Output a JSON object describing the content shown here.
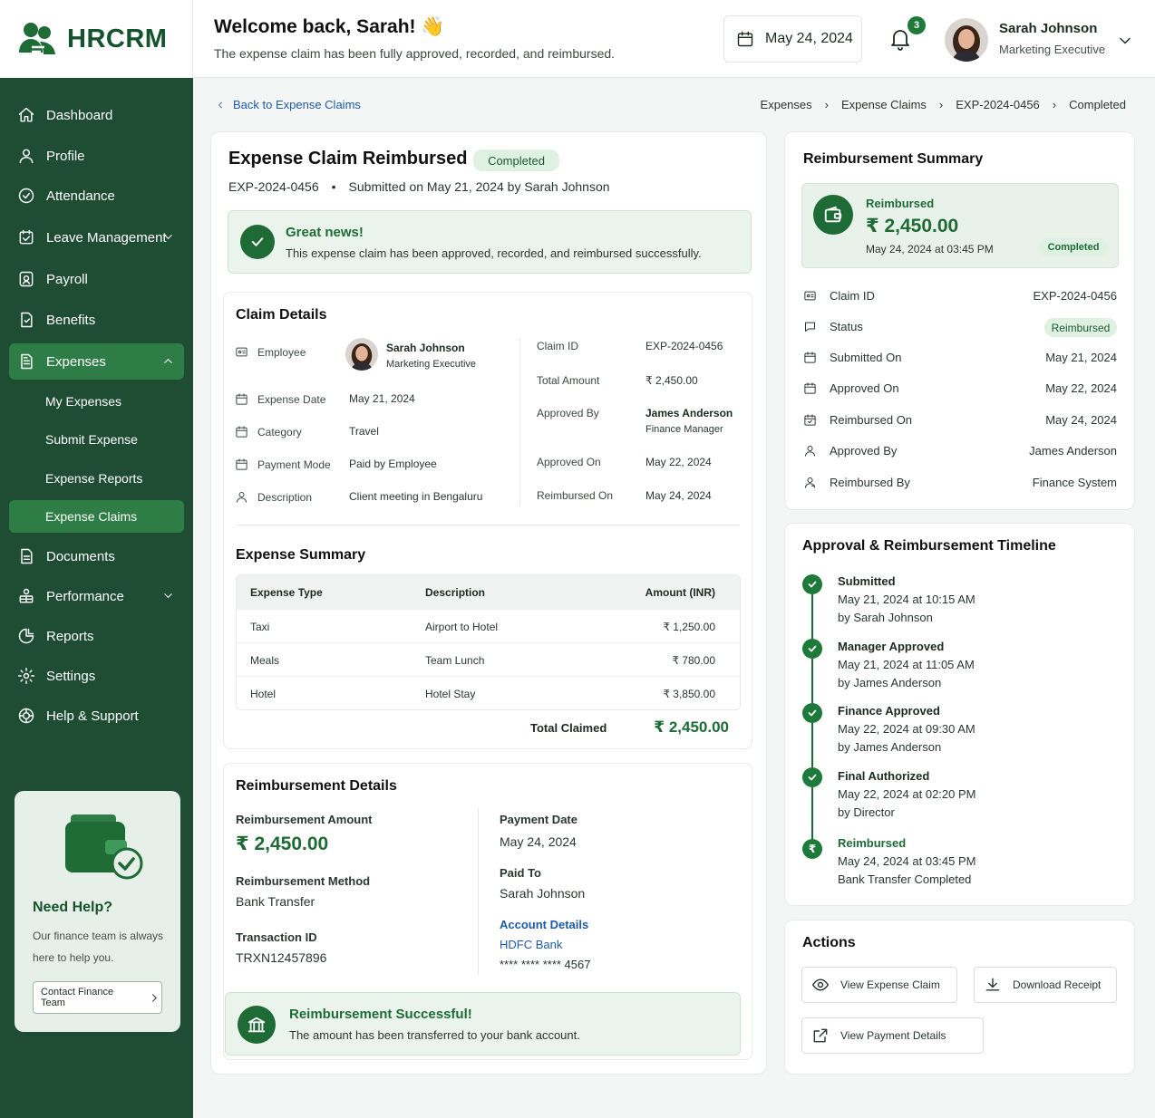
{
  "app": {
    "name": "HRCRM"
  },
  "sidebar": {
    "items": [
      {
        "label": "Dashboard"
      },
      {
        "label": "Profile"
      },
      {
        "label": "Attendance"
      },
      {
        "label": "Leave Management"
      },
      {
        "label": "Payroll"
      },
      {
        "label": "Benefits"
      },
      {
        "label": "Expenses"
      },
      {
        "label": "Documents"
      },
      {
        "label": "Performance"
      },
      {
        "label": "Reports"
      },
      {
        "label": "Settings"
      },
      {
        "label": "Help & Support"
      }
    ],
    "sub_items": [
      {
        "label": "My Expenses"
      },
      {
        "label": "Submit Expense"
      },
      {
        "label": "Expense Reports"
      },
      {
        "label": "Expense Claims"
      }
    ],
    "help": {
      "title": "Need Help?",
      "text": "Our finance team is always here to help you.",
      "button": "Contact Finance Team"
    }
  },
  "header": {
    "welcome": "Welcome back, Sarah! 👋",
    "subtitle": "The expense claim has been fully approved, recorded, and reimbursed.",
    "date": "May 24, 2024",
    "notification_count": "3",
    "user_name": "Sarah Johnson",
    "user_role": "Marketing Executive"
  },
  "breadcrumb": {
    "back": "Back to Expense Claims",
    "items": [
      "Expenses",
      "Expense Claims",
      "EXP-2024-0456",
      "Completed"
    ]
  },
  "claim": {
    "title": "Expense Claim Reimbursed",
    "status": "Completed",
    "id": "EXP-2024-0456",
    "submitted": "Submitted on May 21, 2024 by Sarah Johnson",
    "alert_title": "Great news!",
    "alert_text": "This expense claim has been approved, recorded, and reimbursed successfully."
  },
  "details": {
    "title": "Claim Details",
    "employee_label": "Employee",
    "employee_name": "Sarah Johnson",
    "employee_role": "Marketing Executive",
    "date_label": "Expense Date",
    "date": "May 21, 2024",
    "category_label": "Category",
    "category": "Travel",
    "payment_label": "Payment Mode",
    "payment": "Paid by Employee",
    "desc_label": "Description",
    "desc": "Client meeting in Bengaluru",
    "claim_id_label": "Claim ID",
    "claim_id": "EXP-2024-0456",
    "total_label": "Total Amount",
    "total": "₹ 2,450.00",
    "approved_by_label": "Approved By",
    "approved_by": "James Anderson",
    "approved_by_role": "Finance Manager",
    "approved_on_label": "Approved On",
    "approved_on": "May 22, 2024",
    "reimbursed_on_label": "Reimbursed On",
    "reimbursed_on": "May 24, 2024"
  },
  "expense_summary": {
    "title": "Expense Summary",
    "columns": [
      "Expense Type",
      "Description",
      "Amount (INR)"
    ],
    "rows": [
      {
        "type": "Taxi",
        "desc": "Airport to Hotel",
        "amount": "₹ 1,250.00"
      },
      {
        "type": "Meals",
        "desc": "Team Lunch",
        "amount": "₹ 780.00"
      },
      {
        "type": "Hotel",
        "desc": "Hotel Stay",
        "amount": "₹ 3,850.00"
      }
    ],
    "total_label": "Total Claimed",
    "total": "₹ 2,450.00"
  },
  "reimbursement": {
    "title": "Reimbursement Details",
    "amount_label": "Reimbursement Amount",
    "amount": "₹ 2,450.00",
    "method_label": "Reimbursement Method",
    "method": "Bank Transfer",
    "txn_label": "Transaction ID",
    "txn": "TRXN12457896",
    "date_label": "Payment Date",
    "date": "May 24, 2024",
    "paid_to_label": "Paid To",
    "paid_to": "Sarah Johnson",
    "account_label": "Account Details",
    "bank": "HDFC Bank",
    "account": "**** **** **** 4567",
    "success_title": "Reimbursement Successful!",
    "success_text": "The amount has been transferred to your bank account."
  },
  "summary": {
    "title": "Reimbursement Summary",
    "status_label": "Reimbursed",
    "amount": "₹ 2,450.00",
    "datetime": "May 24, 2024 at 03:45 PM",
    "badge": "Completed",
    "rows": [
      {
        "label": "Claim ID",
        "value": "EXP-2024-0456"
      },
      {
        "label": "Status",
        "value": "Reimbursed"
      },
      {
        "label": "Submitted On",
        "value": "May 21, 2024"
      },
      {
        "label": "Approved On",
        "value": "May 22, 2024"
      },
      {
        "label": "Reimbursed On",
        "value": "May 24, 2024"
      },
      {
        "label": "Approved By",
        "value": "James Anderson"
      },
      {
        "label": "Reimbursed By",
        "value": "Finance System"
      }
    ]
  },
  "timeline": {
    "title": "Approval & Reimbursement Timeline",
    "steps": [
      {
        "title": "Submitted",
        "time": "May 21, 2024 at 10:15 AM",
        "by": "by Sarah Johnson"
      },
      {
        "title": "Manager Approved",
        "time": "May 21, 2024 at 11:05 AM",
        "by": "by James Anderson"
      },
      {
        "title": "Finance Approved",
        "time": "May 22, 2024 at 09:30 AM",
        "by": "by James Anderson"
      },
      {
        "title": "Final Authorized",
        "time": "May 22, 2024 at 02:20 PM",
        "by": "by Director"
      },
      {
        "title": "Reimbursed",
        "time": "May 24, 2024 at 03:45 PM",
        "by": "Bank Transfer Completed"
      }
    ]
  },
  "actions": {
    "title": "Actions",
    "view_claim": "View Expense Claim",
    "download": "Download Receipt",
    "view_payment": "View Payment Details"
  },
  "colors": {
    "brand": "#1e4d33",
    "accent": "#2e7d46",
    "success_bg": "#e8f5ea",
    "link": "#1e5aa8"
  }
}
